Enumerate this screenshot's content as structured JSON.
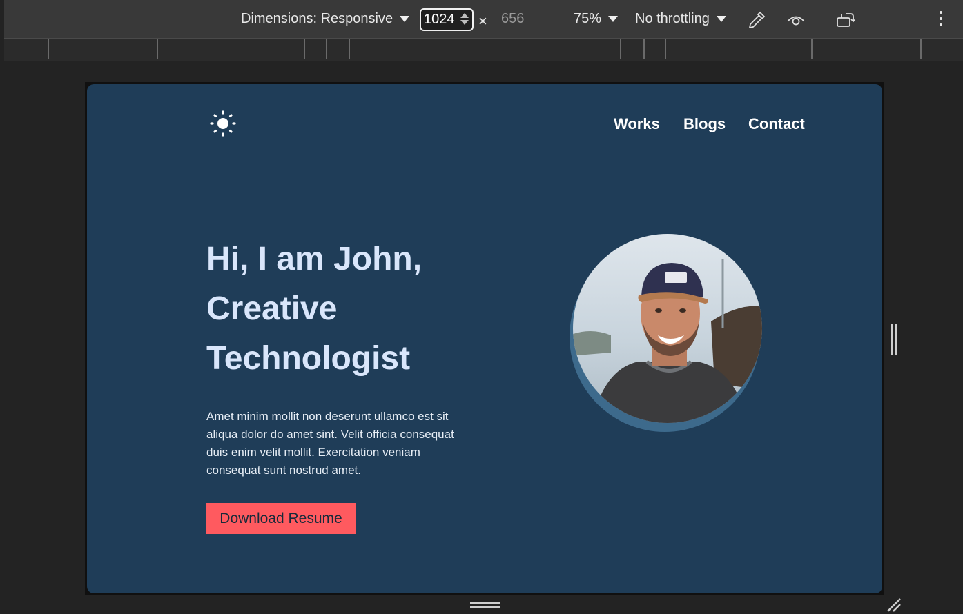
{
  "devtools": {
    "dimensions_label": "Dimensions: Responsive",
    "width_value": "1024",
    "times_symbol": "×",
    "height_value": "656",
    "zoom": "75%",
    "throttling": "No throttling"
  },
  "site": {
    "nav": {
      "works": "Works",
      "blogs": "Blogs",
      "contact": "Contact"
    },
    "hero": {
      "title_line1": "Hi, I am John,",
      "title_line2": "Creative",
      "title_line3": "Technologist",
      "description": "Amet minim mollit non deserunt ullamco est sit aliqua dolor do amet sint. Velit officia consequat duis enim velit mollit. Exercitation veniam consequat sunt nostrud amet.",
      "cta": "Download Resume"
    }
  },
  "colors": {
    "page_bg": "#1f3d58",
    "accent": "#ff5a5f",
    "title": "#d9e6fb",
    "avatar_ring": "#3d6a8c"
  }
}
